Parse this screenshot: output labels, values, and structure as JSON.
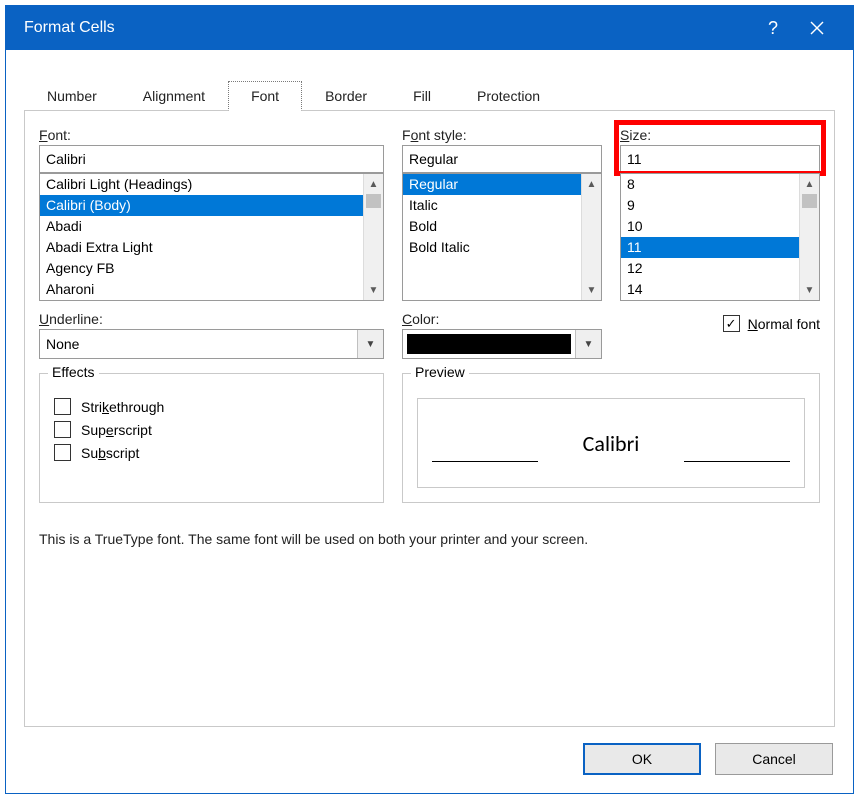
{
  "window": {
    "title": "Format Cells",
    "help_glyph": "?",
    "close_glyph": "✕"
  },
  "tabs": [
    {
      "label": "Number"
    },
    {
      "label": "Alignment"
    },
    {
      "label": "Font",
      "active": true
    },
    {
      "label": "Border"
    },
    {
      "label": "Fill"
    },
    {
      "label": "Protection"
    }
  ],
  "font": {
    "label_html": "<span class='underline-char'>F</span>ont:",
    "value": "Calibri",
    "items": [
      {
        "label": "Calibri Light (Headings)"
      },
      {
        "label": "Calibri (Body)",
        "selected": true
      },
      {
        "label": "Abadi"
      },
      {
        "label": "Abadi Extra Light"
      },
      {
        "label": "Agency FB"
      },
      {
        "label": "Aharoni"
      }
    ]
  },
  "font_style": {
    "label_html": "F<span class='underline-char'>o</span>nt style:",
    "value": "Regular",
    "items": [
      {
        "label": "Regular",
        "selected": true
      },
      {
        "label": "Italic"
      },
      {
        "label": "Bold"
      },
      {
        "label": "Bold Italic"
      }
    ]
  },
  "size": {
    "label_html": "<span class='underline-char'>S</span>ize:",
    "value": "11",
    "items": [
      {
        "label": "8"
      },
      {
        "label": "9"
      },
      {
        "label": "10"
      },
      {
        "label": "11",
        "selected": true
      },
      {
        "label": "12"
      },
      {
        "label": "14"
      }
    ]
  },
  "underline": {
    "label_html": "<span class='underline-char'>U</span>nderline:",
    "value": "None"
  },
  "color": {
    "label_html": "<span class='underline-char'>C</span>olor:",
    "value_hex": "#000000"
  },
  "normal_font": {
    "label_html": "<span class='underline-char'>N</span>ormal font",
    "checked": true
  },
  "effects": {
    "legend": "Effects",
    "strikethrough_html": "Stri<span class='underline-char'>k</span>ethrough",
    "superscript_html": "Sup<span class='underline-char'>e</span>rscript",
    "subscript_html": "Su<span class='underline-char'>b</span>script",
    "strikethrough": false,
    "superscript": false,
    "subscript": false
  },
  "preview": {
    "legend": "Preview",
    "text": "Calibri"
  },
  "hint": "This is a TrueType font.  The same font will be used on both your printer and your screen.",
  "buttons": {
    "ok": "OK",
    "cancel": "Cancel"
  },
  "annotation": {
    "present": true,
    "target": "size-input"
  }
}
